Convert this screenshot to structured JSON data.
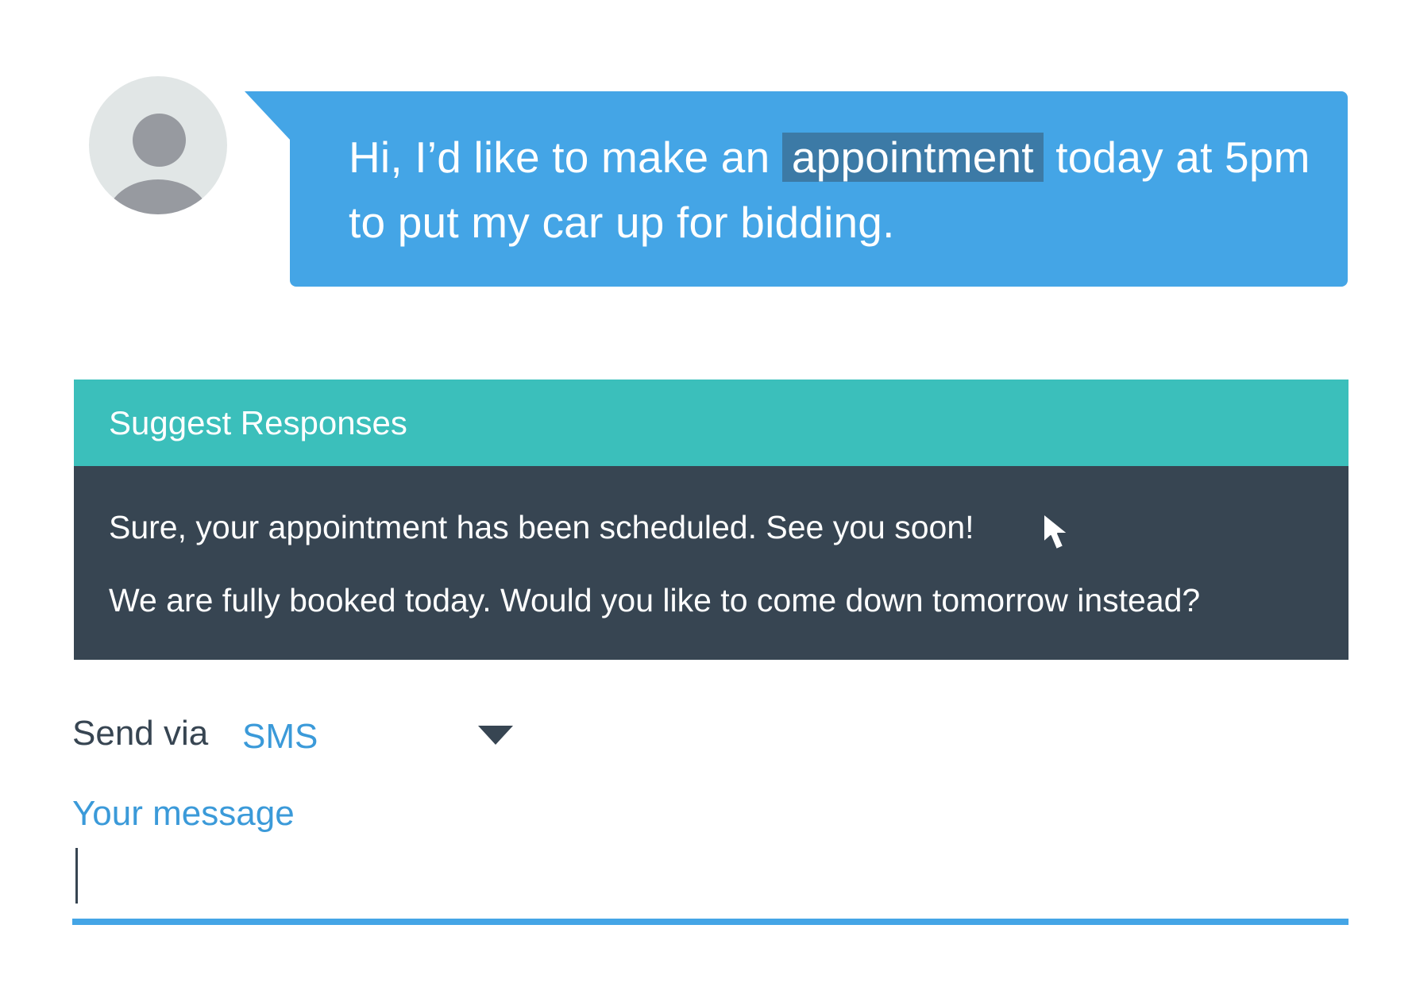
{
  "message": {
    "text_before": "Hi, I’d like to make an",
    "highlighted_word": "appointment",
    "text_after": "today at 5pm to put my car up for bidding."
  },
  "suggest": {
    "title": "Suggest Responses",
    "responses": [
      "Sure, your appointment has been scheduled. See you soon!",
      "We are fully booked today. Would you like to come down tomorrow instead?"
    ]
  },
  "send_via": {
    "label": "Send via",
    "selected": "SMS"
  },
  "compose": {
    "label": "Your message",
    "value": ""
  },
  "colors": {
    "bubble": "#44a5e6",
    "highlight": "#3c7aa6",
    "suggest_header": "#3bbfbb",
    "suggest_body": "#374552",
    "accent_text": "#3b9ad9"
  },
  "icons": {
    "avatar": "user-silhouette",
    "pointer": "mouse-pointer-arrow",
    "dropdown": "triangle-down"
  }
}
